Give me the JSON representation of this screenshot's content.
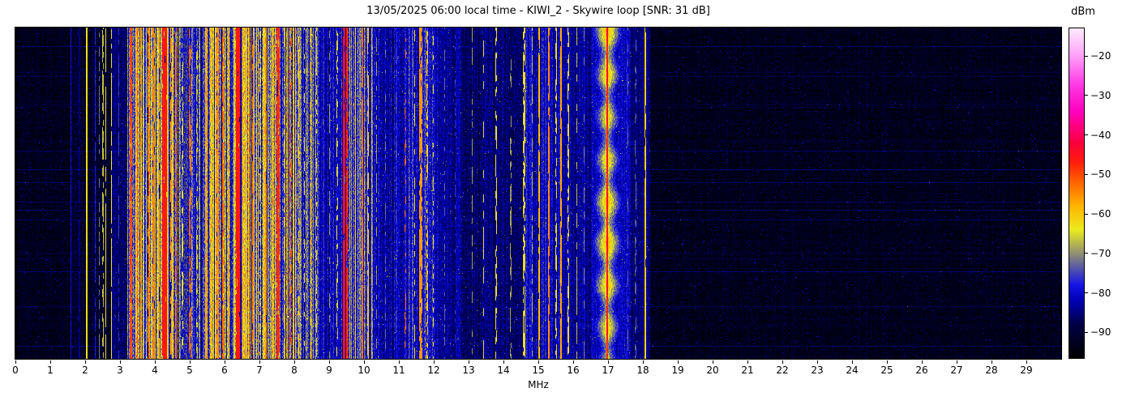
{
  "figure": {
    "title": "13/05/2025 06:00 local time - KIWI_2 - Skywire loop [SNR: 31 dB]",
    "background_color": "#ffffff"
  },
  "x_axis": {
    "label": "MHz",
    "min_mhz": 0,
    "max_mhz": 30,
    "tick_step_mhz": 1,
    "tick_labels": [
      "0",
      "1",
      "2",
      "3",
      "4",
      "5",
      "6",
      "7",
      "8",
      "9",
      "10",
      "11",
      "12",
      "13",
      "14",
      "15",
      "16",
      "17",
      "18",
      "19",
      "20",
      "21",
      "22",
      "23",
      "24",
      "25",
      "26",
      "27",
      "28",
      "29"
    ]
  },
  "colorbar": {
    "label": "dBm",
    "vmax_dbm": -13,
    "vmin_dbm": -96.5,
    "ticks": [
      {
        "value": -20,
        "label": "−20"
      },
      {
        "value": -30,
        "label": "−30"
      },
      {
        "value": -40,
        "label": "−40"
      },
      {
        "value": -50,
        "label": "−50"
      },
      {
        "value": -60,
        "label": "−60"
      },
      {
        "value": -70,
        "label": "−70"
      },
      {
        "value": -80,
        "label": "−80"
      },
      {
        "value": -90,
        "label": "−90"
      }
    ],
    "gradient_stops": [
      {
        "value": -13,
        "color": "#ffebff"
      },
      {
        "value": -20,
        "color": "#ffa0f8"
      },
      {
        "value": -27,
        "color": "#ff3ce6"
      },
      {
        "value": -34,
        "color": "#ff00be"
      },
      {
        "value": -42,
        "color": "#fa003c"
      },
      {
        "value": -47,
        "color": "#ff1e0a"
      },
      {
        "value": -52,
        "color": "#ff6400"
      },
      {
        "value": -58,
        "color": "#ffb400"
      },
      {
        "value": -64,
        "color": "#ebeb1e"
      },
      {
        "value": -71,
        "color": "#808080"
      },
      {
        "value": -78,
        "color": "#1414e6"
      },
      {
        "value": -82,
        "color": "#0000b4"
      },
      {
        "value": -88,
        "color": "#000046"
      },
      {
        "value": -96.5,
        "color": "#000000"
      }
    ]
  },
  "chart_data": {
    "type": "heatmap",
    "subtype": "radio-spectrogram-waterfall",
    "title": "13/05/2025 06:00 local time - KIWI_2 - Skywire loop [SNR: 31 dB]",
    "snr_db": 31,
    "x_unit": "MHz",
    "x_range": [
      0,
      30
    ],
    "value_unit": "dBm",
    "value_range": [
      -96.5,
      -13
    ],
    "noise_floor_dbm": -93,
    "legend_position": "right-colorbar",
    "grid": false,
    "region_format": [
      "f0_mhz",
      "f1_mhz",
      "base_dbm",
      "speckle_db",
      "stripe_db"
    ],
    "regions": [
      [
        0.0,
        1.55,
        -93,
        5,
        1
      ],
      [
        1.55,
        2.72,
        -91,
        6,
        2
      ],
      [
        2.72,
        3.2,
        -86,
        5,
        2
      ],
      [
        3.2,
        4.72,
        -72,
        10,
        14
      ],
      [
        4.72,
        5.38,
        -79,
        9,
        8
      ],
      [
        5.38,
        8.05,
        -71,
        10,
        14
      ],
      [
        8.05,
        8.72,
        -77,
        9,
        9
      ],
      [
        8.72,
        9.3,
        -82,
        7,
        5
      ],
      [
        9.3,
        10.25,
        -77,
        8,
        8
      ],
      [
        10.25,
        11.2,
        -82,
        7,
        4
      ],
      [
        11.2,
        12.1,
        -79,
        8,
        6
      ],
      [
        12.1,
        12.78,
        -84,
        6,
        3
      ],
      [
        12.78,
        14.6,
        -86,
        6,
        3
      ],
      [
        14.6,
        15.75,
        -81,
        7,
        5
      ],
      [
        15.75,
        16.5,
        -84,
        6,
        3
      ],
      [
        16.5,
        17.65,
        -81,
        6,
        2
      ],
      [
        17.65,
        18.2,
        -86,
        5,
        2
      ],
      [
        18.2,
        30.0,
        -93,
        5,
        1
      ]
    ],
    "line_format": [
      "freq_mhz",
      "width_mhz",
      "level_dbm",
      "duty_fraction"
    ],
    "lines": [
      [
        1.58,
        0.03,
        -79,
        1
      ],
      [
        1.82,
        0.03,
        -83,
        0.8
      ],
      [
        2.04,
        0.035,
        -63,
        1
      ],
      [
        2.28,
        0.03,
        -77,
        0.9
      ],
      [
        2.4,
        0.03,
        -72,
        0.5
      ],
      [
        2.5,
        0.035,
        -67,
        0.6
      ],
      [
        2.58,
        0.04,
        -63,
        0.9
      ],
      [
        2.74,
        0.035,
        -64,
        0.85
      ],
      [
        2.95,
        0.03,
        -76,
        0.5
      ],
      [
        3.3,
        0.06,
        -50,
        0.9
      ],
      [
        3.45,
        0.04,
        -62,
        0.7
      ],
      [
        3.6,
        0.05,
        -57,
        0.75
      ],
      [
        3.8,
        0.04,
        -60,
        0.7
      ],
      [
        3.95,
        0.06,
        -54,
        0.8
      ],
      [
        4.1,
        0.04,
        -58,
        0.7
      ],
      [
        4.27,
        0.13,
        -46,
        0.97
      ],
      [
        4.45,
        0.04,
        -56,
        0.7
      ],
      [
        4.6,
        0.05,
        -53,
        0.75
      ],
      [
        4.78,
        0.03,
        -64,
        0.5
      ],
      [
        5.0,
        0.05,
        -53,
        0.55
      ],
      [
        5.2,
        0.03,
        -66,
        0.5
      ],
      [
        5.45,
        0.05,
        -57,
        0.8
      ],
      [
        5.6,
        0.04,
        -61,
        0.7
      ],
      [
        5.78,
        0.05,
        -55,
        0.75
      ],
      [
        5.95,
        0.05,
        -52,
        0.8
      ],
      [
        6.1,
        0.04,
        -57,
        0.7
      ],
      [
        6.38,
        0.11,
        -46,
        0.97
      ],
      [
        6.6,
        0.04,
        -57,
        0.7
      ],
      [
        6.8,
        0.05,
        -54,
        0.75
      ],
      [
        7.0,
        0.04,
        -60,
        0.6
      ],
      [
        7.18,
        0.05,
        -55,
        0.75
      ],
      [
        7.35,
        0.04,
        -58,
        0.7
      ],
      [
        7.52,
        0.08,
        -48,
        0.9
      ],
      [
        7.7,
        0.04,
        -57,
        0.6
      ],
      [
        7.9,
        0.05,
        -52,
        0.35
      ],
      [
        8.1,
        0.04,
        -60,
        0.5
      ],
      [
        8.28,
        0.03,
        -64,
        0.45
      ],
      [
        8.45,
        0.04,
        -57,
        0.4
      ],
      [
        8.62,
        0.03,
        -66,
        0.5
      ],
      [
        9.0,
        0.03,
        -70,
        0.5
      ],
      [
        9.22,
        0.03,
        -66,
        0.5
      ],
      [
        9.42,
        0.05,
        -44,
        0.95
      ],
      [
        9.5,
        0.03,
        -48,
        0.9
      ],
      [
        9.58,
        0.04,
        -57,
        0.8
      ],
      [
        9.75,
        0.03,
        -63,
        0.6
      ],
      [
        9.95,
        0.05,
        -53,
        0.9
      ],
      [
        10.1,
        0.035,
        -61,
        0.7
      ],
      [
        10.35,
        0.03,
        -69,
        0.45
      ],
      [
        10.6,
        0.025,
        -72,
        0.4
      ],
      [
        10.9,
        0.025,
        -74,
        0.35
      ],
      [
        11.18,
        0.045,
        -52,
        0.25
      ],
      [
        11.45,
        0.03,
        -63,
        0.5
      ],
      [
        11.62,
        0.08,
        -56,
        0.85
      ],
      [
        11.8,
        0.04,
        -61,
        0.55
      ],
      [
        11.98,
        0.035,
        -65,
        0.45
      ],
      [
        12.3,
        0.03,
        -73,
        0.4
      ],
      [
        12.6,
        0.025,
        -76,
        0.35
      ],
      [
        13.1,
        0.03,
        -69,
        0.5
      ],
      [
        13.42,
        0.03,
        -65,
        0.6
      ],
      [
        13.78,
        0.035,
        -63,
        0.55
      ],
      [
        14.2,
        0.03,
        -69,
        0.45
      ],
      [
        14.58,
        0.05,
        -63,
        0.6
      ],
      [
        14.82,
        0.03,
        -67,
        0.5
      ],
      [
        15.02,
        0.04,
        -59,
        0.9
      ],
      [
        15.3,
        0.05,
        -55,
        0.9
      ],
      [
        15.5,
        0.03,
        -64,
        0.6
      ],
      [
        15.65,
        0.045,
        -57,
        0.95
      ],
      [
        15.85,
        0.03,
        -63,
        0.6
      ],
      [
        16.1,
        0.03,
        -67,
        0.5
      ],
      [
        16.3,
        0.025,
        -71,
        0.4
      ],
      [
        17.55,
        0.03,
        -73,
        0.3
      ],
      [
        17.78,
        0.03,
        -73,
        0.3
      ],
      [
        18.06,
        0.035,
        -61,
        0.95
      ]
    ],
    "strong_carrier": {
      "freq_mhz": 16.97,
      "core_width_mhz": 0.045,
      "core_level_dbm": -46,
      "halo_width_mhz": 0.42,
      "halo_level_dbm": -63,
      "halo_blob_period_rows": 52
    }
  }
}
